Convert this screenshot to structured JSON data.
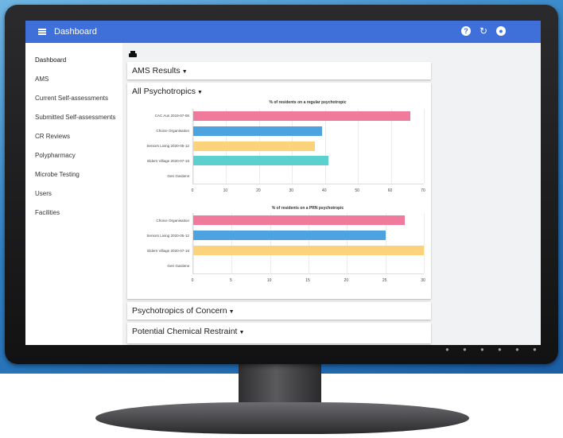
{
  "app": {
    "title": "Dashboard",
    "header_icons": [
      "help-icon",
      "refresh-icon",
      "account-icon"
    ]
  },
  "sidebar": {
    "items": [
      {
        "label": "Dashboard"
      },
      {
        "label": "AMS"
      },
      {
        "label": "Current Self-assessments"
      },
      {
        "label": "Submitted Self-assessments"
      },
      {
        "label": "CR Reviews"
      },
      {
        "label": "Polypharmacy"
      },
      {
        "label": "Microbe Testing"
      },
      {
        "label": "Users"
      },
      {
        "label": "Facilities"
      }
    ]
  },
  "sections": {
    "ams_results": "AMS Results",
    "all_psychotropics": "All Psychotropics",
    "psychotropics_of_concern": "Psychotropics of Concern",
    "potential_chemical_restraint": "Potential Chemical Restraint"
  },
  "colors": {
    "app_bar": "#3f6fd8",
    "pink": "#f07a9b",
    "blue": "#4da3e0",
    "yellow": "#fcd27b",
    "teal": "#5ccfcf"
  },
  "chart_data": [
    {
      "type": "bar",
      "orientation": "horizontal",
      "title": "% of residents on a regular psychotropic",
      "categories": [
        "CAC Aus 2019-07-08",
        "Choice Organisation",
        "Seniors Living 2020-05-12",
        "Elders Village 2020-07-16",
        "Geri Gardens"
      ],
      "values": [
        66,
        39,
        37,
        41,
        0
      ],
      "bar_colors": [
        "#f07a9b",
        "#4da3e0",
        "#fcd27b",
        "#5ccfcf",
        "#cccccc"
      ],
      "xlim": [
        0,
        70
      ],
      "xticks": [
        "0",
        "10",
        "20",
        "30",
        "40",
        "50",
        "60",
        "70"
      ],
      "grid": true
    },
    {
      "type": "bar",
      "orientation": "horizontal",
      "title": "% of residents on a PRN psychotropic",
      "categories": [
        "Choice Organisation",
        "Seniors Living 2020-05-12",
        "Elders Village 2020-07-16",
        "Geri Gardens"
      ],
      "values": [
        27.5,
        25,
        30,
        0
      ],
      "bar_colors": [
        "#f07a9b",
        "#4da3e0",
        "#fcd27b",
        "#cccccc"
      ],
      "xlim": [
        0,
        30
      ],
      "xticks": [
        "0",
        "5",
        "10",
        "15",
        "20",
        "25",
        "30"
      ],
      "grid": true
    }
  ]
}
